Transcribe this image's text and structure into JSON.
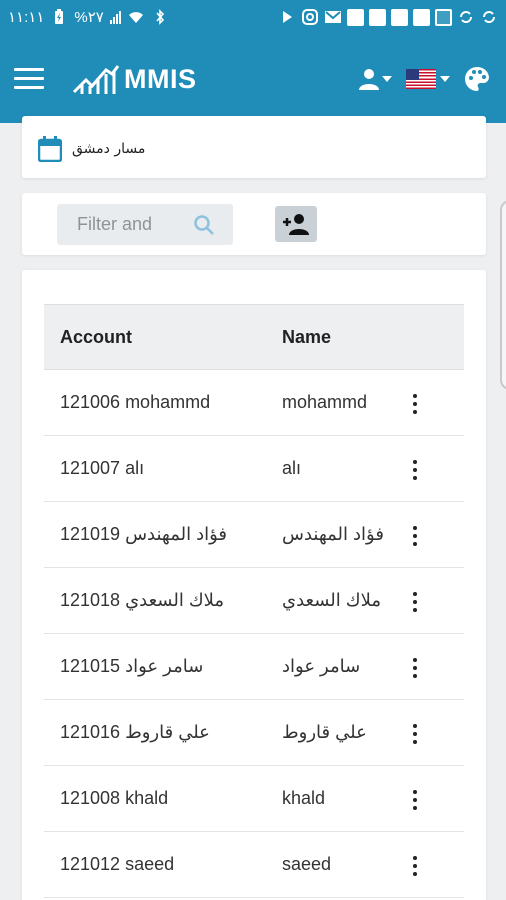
{
  "status_bar": {
    "time": "١١:١١",
    "battery": "%٢٧",
    "signal_label": "ll.",
    "left_icons": [
      "battery-charging-icon",
      "signal-icon",
      "wifi-icon",
      "bluetooth-icon"
    ],
    "right_icons": [
      "play-icon",
      "instagram-icon",
      "gmail-icon",
      "app-icon",
      "app-icon",
      "app-icon",
      "app-icon",
      "image-icon",
      "sync-icon",
      "sync-icon"
    ]
  },
  "app_bar": {
    "title": "MMIS",
    "menu_icon": "hamburger-icon",
    "user_icon": "user-dropdown-icon",
    "language_flag": "us-flag",
    "theme_icon": "palette-icon",
    "color": "#1f8db8"
  },
  "route": {
    "label": "مسار دمشق",
    "icon": "calendar-icon"
  },
  "filter": {
    "placeholder": "Filter and",
    "search_icon": "search-icon",
    "add_icon": "add-user-icon"
  },
  "table": {
    "columns": [
      "Account",
      "Name"
    ],
    "rows": [
      {
        "account": "121006 mohammd",
        "name": "mohammd"
      },
      {
        "account": "121007 alı",
        "name": "alı"
      },
      {
        "account": "121019 فؤاد المهندس",
        "name": "فؤاد المهندس"
      },
      {
        "account": "121018 ملاك السعدي",
        "name": "ملاك السعدي"
      },
      {
        "account": "121015 سامر عواد",
        "name": "سامر عواد"
      },
      {
        "account": "121016 علي قاروط",
        "name": "علي قاروط"
      },
      {
        "account": "121008 khald",
        "name": "khald"
      },
      {
        "account": "121012 saeed",
        "name": "saeed"
      }
    ]
  }
}
